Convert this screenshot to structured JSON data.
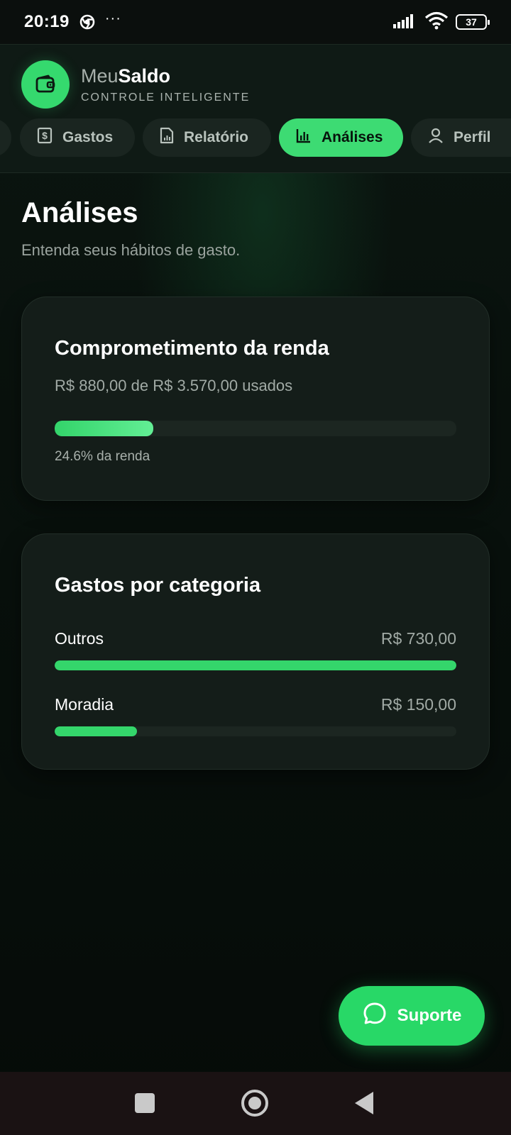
{
  "status_bar": {
    "time": "20:19",
    "dots": "···",
    "battery": "37",
    "icons": [
      "chrome-icon",
      "signal-icon",
      "wifi-icon",
      "battery-icon"
    ]
  },
  "header": {
    "brand_light": "Meu",
    "brand_bold": "Saldo",
    "tagline": "CONTROLE INTELIGENTE",
    "logo_icon": "wallet-icon"
  },
  "tabs": [
    {
      "label": "Gastos",
      "icon": "dollar-receipt-icon",
      "active": false
    },
    {
      "label": "Relatório",
      "icon": "report-file-icon",
      "active": false
    },
    {
      "label": "Análises",
      "icon": "bar-chart-icon",
      "active": true
    },
    {
      "label": "Perfil",
      "icon": "user-icon",
      "active": false
    }
  ],
  "page": {
    "title": "Análises",
    "subtitle": "Entenda seus hábitos de gasto."
  },
  "income_card": {
    "title": "Comprometimento da renda",
    "detail": "R$ 880,00 de R$ 3.570,00 usados",
    "percent_label": "24.6% da renda",
    "progress": 0.246
  },
  "category_card": {
    "title": "Gastos por categoria",
    "items": [
      {
        "name": "Outros",
        "value": "R$ 730,00",
        "fraction": 1.0
      },
      {
        "name": "Moradia",
        "value": "R$ 150,00",
        "fraction": 0.205
      }
    ]
  },
  "support": {
    "label": "Suporte",
    "icon": "chat-bubble-icon"
  },
  "colors": {
    "accent": "#3ddb73",
    "background": "#07110c",
    "card": "#141d19"
  }
}
